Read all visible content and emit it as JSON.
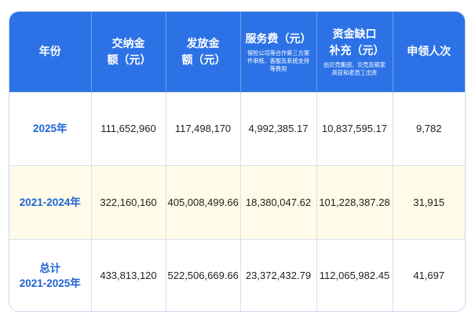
{
  "headers": [
    {
      "main": "年份",
      "note": ""
    },
    {
      "main": "交纳金额（元）",
      "note": ""
    },
    {
      "main": "发放金额（元）",
      "note": ""
    },
    {
      "main": "服务费（元）",
      "note": "保险公司等合作第三方案件审核、客服及系统支持等费用"
    },
    {
      "main": "资金缺口补充（元）",
      "note": "由贝壳集团、贝壳及链家高管和老员工出资"
    },
    {
      "main": "申领人次",
      "note": ""
    }
  ],
  "rows": [
    {
      "year_line1": "2025年",
      "year_line2": "",
      "paid": "111,652,960",
      "disbursed": "117,498,170",
      "service_fee": "4,992,385.17",
      "gap_fill": "10,837,595.17",
      "claims": "9,782"
    },
    {
      "year_line1": "2021-2024年",
      "year_line2": "",
      "paid": "322,160,160",
      "disbursed": "405,008,499.66",
      "service_fee": "18,380,047.62",
      "gap_fill": "101,228,387.28",
      "claims": "31,915"
    },
    {
      "year_line1": "总计",
      "year_line2": "2021-2025年",
      "paid": "433,813,120",
      "disbursed": "522,506,669.66",
      "service_fee": "23,372,432.79",
      "gap_fill": "112,065,982.45",
      "claims": "41,697"
    }
  ],
  "colors": {
    "header_bg": "#2c72e6",
    "year_text": "#1f62d6",
    "highlight_row": "#fffbe8"
  }
}
